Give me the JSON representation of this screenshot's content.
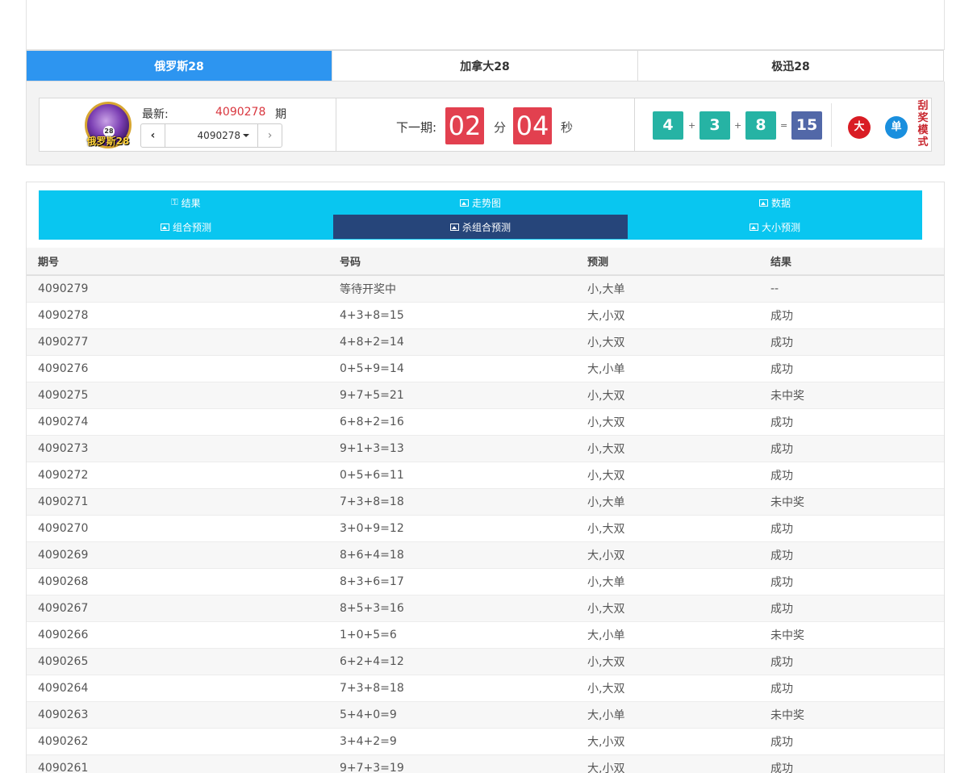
{
  "game_tabs": [
    {
      "label": "俄罗斯28",
      "active": true
    },
    {
      "label": "加拿大28",
      "active": false
    },
    {
      "label": "极迅28",
      "active": false
    }
  ],
  "latest": {
    "logo_text": "俄罗斯28",
    "logo_number": "28",
    "label": "最新:",
    "issue": "4090278",
    "unit": "期",
    "select_value": "4090278"
  },
  "countdown": {
    "label": "下一期:",
    "minutes": "02",
    "minute_unit": "分",
    "seconds": "04",
    "second_unit": "秒"
  },
  "result": {
    "balls": [
      "4",
      "3",
      "8"
    ],
    "plus": "+",
    "equals": "=",
    "sum": "15",
    "size": "大",
    "parity": "单",
    "mode_label": "刮奖模式"
  },
  "sub_tabs": {
    "row1": [
      {
        "label": "结果",
        "icon": "key-icon",
        "active": false
      },
      {
        "label": "走势图",
        "icon": "image-icon",
        "active": false
      },
      {
        "label": "数据",
        "icon": "image-icon",
        "active": false
      }
    ],
    "row2": [
      {
        "label": "组合预测",
        "icon": "image-icon",
        "active": false
      },
      {
        "label": "杀组合预测",
        "icon": "image-icon",
        "active": true
      },
      {
        "label": "大小预测",
        "icon": "image-icon",
        "active": false
      }
    ]
  },
  "table": {
    "headers": [
      "期号",
      "号码",
      "预测",
      "结果"
    ],
    "rows": [
      {
        "issue": "4090279",
        "numbers": "等待开奖中",
        "prediction": "小,大单",
        "result": "--"
      },
      {
        "issue": "4090278",
        "numbers": "4+3+8=15",
        "prediction": "大,小双",
        "result": "成功"
      },
      {
        "issue": "4090277",
        "numbers": "4+8+2=14",
        "prediction": "小,大双",
        "result": "成功"
      },
      {
        "issue": "4090276",
        "numbers": "0+5+9=14",
        "prediction": "大,小单",
        "result": "成功"
      },
      {
        "issue": "4090275",
        "numbers": "9+7+5=21",
        "prediction": "小,大双",
        "result": "未中奖"
      },
      {
        "issue": "4090274",
        "numbers": "6+8+2=16",
        "prediction": "小,大双",
        "result": "成功"
      },
      {
        "issue": "4090273",
        "numbers": "9+1+3=13",
        "prediction": "小,大双",
        "result": "成功"
      },
      {
        "issue": "4090272",
        "numbers": "0+5+6=11",
        "prediction": "小,大双",
        "result": "成功"
      },
      {
        "issue": "4090271",
        "numbers": "7+3+8=18",
        "prediction": "小,大单",
        "result": "未中奖"
      },
      {
        "issue": "4090270",
        "numbers": "3+0+9=12",
        "prediction": "小,大双",
        "result": "成功"
      },
      {
        "issue": "4090269",
        "numbers": "8+6+4=18",
        "prediction": "大,小双",
        "result": "成功"
      },
      {
        "issue": "4090268",
        "numbers": "8+3+6=17",
        "prediction": "小,大单",
        "result": "成功"
      },
      {
        "issue": "4090267",
        "numbers": "8+5+3=16",
        "prediction": "小,大双",
        "result": "成功"
      },
      {
        "issue": "4090266",
        "numbers": "1+0+5=6",
        "prediction": "大,小单",
        "result": "未中奖"
      },
      {
        "issue": "4090265",
        "numbers": "6+2+4=12",
        "prediction": "小,大双",
        "result": "成功"
      },
      {
        "issue": "4090264",
        "numbers": "7+3+8=18",
        "prediction": "小,大双",
        "result": "成功"
      },
      {
        "issue": "4090263",
        "numbers": "5+4+0=9",
        "prediction": "大,小单",
        "result": "未中奖"
      },
      {
        "issue": "4090262",
        "numbers": "3+4+2=9",
        "prediction": "大,小双",
        "result": "成功"
      },
      {
        "issue": "4090261",
        "numbers": "9+7+3=19",
        "prediction": "大,小双",
        "result": "成功"
      }
    ]
  },
  "colors": {
    "active_tab": "#2d95f0",
    "subtab_bg": "#09c6f0",
    "subtab_active": "#26457a",
    "countdown_bg": "#e2404f",
    "ball_bg": "#26b3a4",
    "sum_bg": "#5268a8",
    "success_text": "#c8252d"
  }
}
